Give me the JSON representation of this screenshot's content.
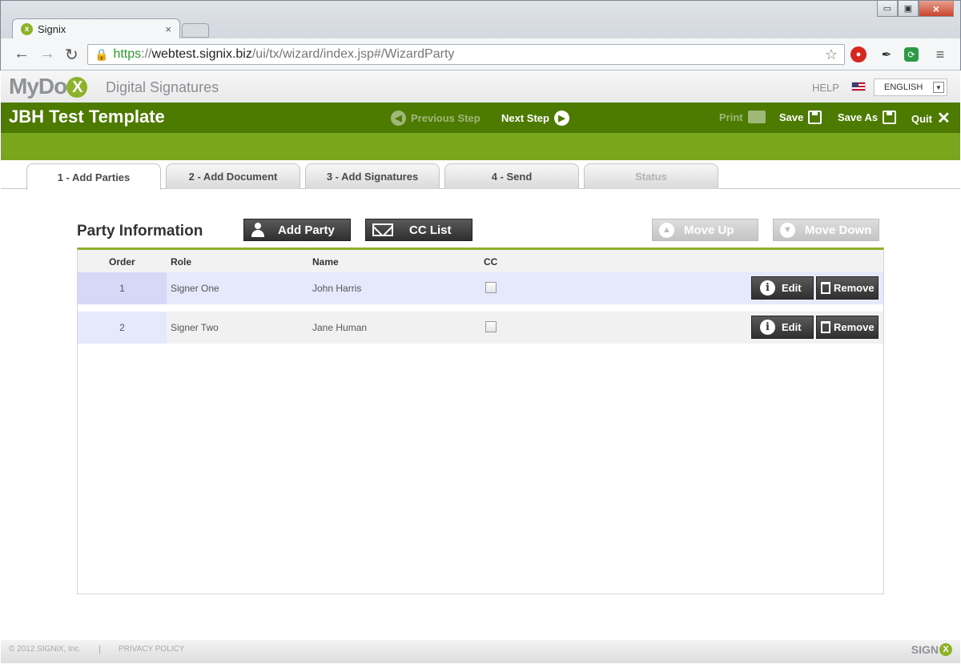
{
  "browser": {
    "tab_title": "Signix",
    "tab_icon": "signix-favicon",
    "tab_close": "×",
    "url_scheme": "https",
    "url_separator": "://",
    "url_host": "webtest.signix.biz",
    "url_path": "/ui/tx/wizard/index.jsp#/WizardParty",
    "window_min": "▭",
    "window_restore": "▣",
    "window_close": "×"
  },
  "app": {
    "logo_text": "MyDo",
    "logo_x": "X",
    "logo_sub": "Digital Signatures",
    "help": "HELP",
    "language": "ENGLISH",
    "title": "JBH Test Template"
  },
  "actions": {
    "previous_step": "Previous Step",
    "next_step": "Next Step",
    "print": "Print",
    "save": "Save",
    "save_as": "Save As",
    "quit": "Quit"
  },
  "steps": [
    {
      "label": "1 - Add Parties",
      "state": "active"
    },
    {
      "label": "2 - Add Document",
      "state": "normal"
    },
    {
      "label": "3 - Add Signatures",
      "state": "normal"
    },
    {
      "label": "4 - Send",
      "state": "normal"
    },
    {
      "label": "Status",
      "state": "disabled"
    }
  ],
  "party": {
    "section_title": "Party Information",
    "add_party": "Add Party",
    "cc_list": "CC List",
    "move_up": "Move Up",
    "move_down": "Move Down",
    "columns": {
      "order": "Order",
      "role": "Role",
      "name": "Name",
      "cc": "CC"
    },
    "rows": [
      {
        "order": "1",
        "role": "Signer One",
        "name": "John Harris",
        "cc": false
      },
      {
        "order": "2",
        "role": "Signer Two",
        "name": "Jane Human",
        "cc": false
      }
    ],
    "edit": "Edit",
    "remove": "Remove"
  },
  "footer": {
    "copyright": "© 2012 SIGNiX, Inc.",
    "separator": "|",
    "privacy": "PRIVACY POLICY",
    "brand": "SIGN",
    "brand_x": "X"
  },
  "colors": {
    "title_bar": "#4d7a00",
    "accent_bar": "#7aa61e",
    "logo_green": "#8db22a",
    "selected_row": "#d6d8f7"
  }
}
